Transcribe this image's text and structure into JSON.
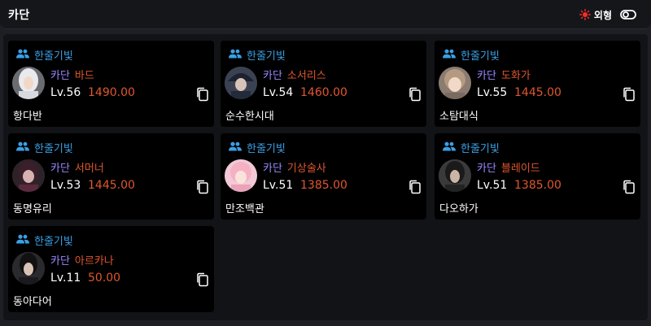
{
  "header": {
    "title": "카단",
    "appearance_label": "외형"
  },
  "colors": {
    "guild": "#3aa0e6",
    "server": "#9a88ff",
    "class_and_ilvl": "#e0572d",
    "accent_sun": "#ff2a2a"
  },
  "icons": {
    "guild": "people-icon",
    "copy": "copy-icon",
    "appearance": "sun-icon",
    "toggle": "toggle-icon"
  },
  "characters": [
    {
      "guild": "한줄기빛",
      "server": "카단",
      "class": "바드",
      "level": "Lv.56",
      "item_level": "1490.00",
      "name": "항다반"
    },
    {
      "guild": "한줄기빛",
      "server": "카단",
      "class": "소서리스",
      "level": "Lv.54",
      "item_level": "1460.00",
      "name": "순수한시대"
    },
    {
      "guild": "한줄기빛",
      "server": "카단",
      "class": "도화가",
      "level": "Lv.55",
      "item_level": "1445.00",
      "name": "소탐대식"
    },
    {
      "guild": "한줄기빛",
      "server": "카단",
      "class": "서머너",
      "level": "Lv.53",
      "item_level": "1445.00",
      "name": "동명유리"
    },
    {
      "guild": "한줄기빛",
      "server": "카단",
      "class": "기상술사",
      "level": "Lv.51",
      "item_level": "1385.00",
      "name": "만조백관"
    },
    {
      "guild": "한줄기빛",
      "server": "카단",
      "class": "블레이드",
      "level": "Lv.51",
      "item_level": "1385.00",
      "name": "다오하가"
    },
    {
      "guild": "한줄기빛",
      "server": "카단",
      "class": "아르카나",
      "level": "Lv.11",
      "item_level": "50.00",
      "name": "동아다어"
    }
  ]
}
